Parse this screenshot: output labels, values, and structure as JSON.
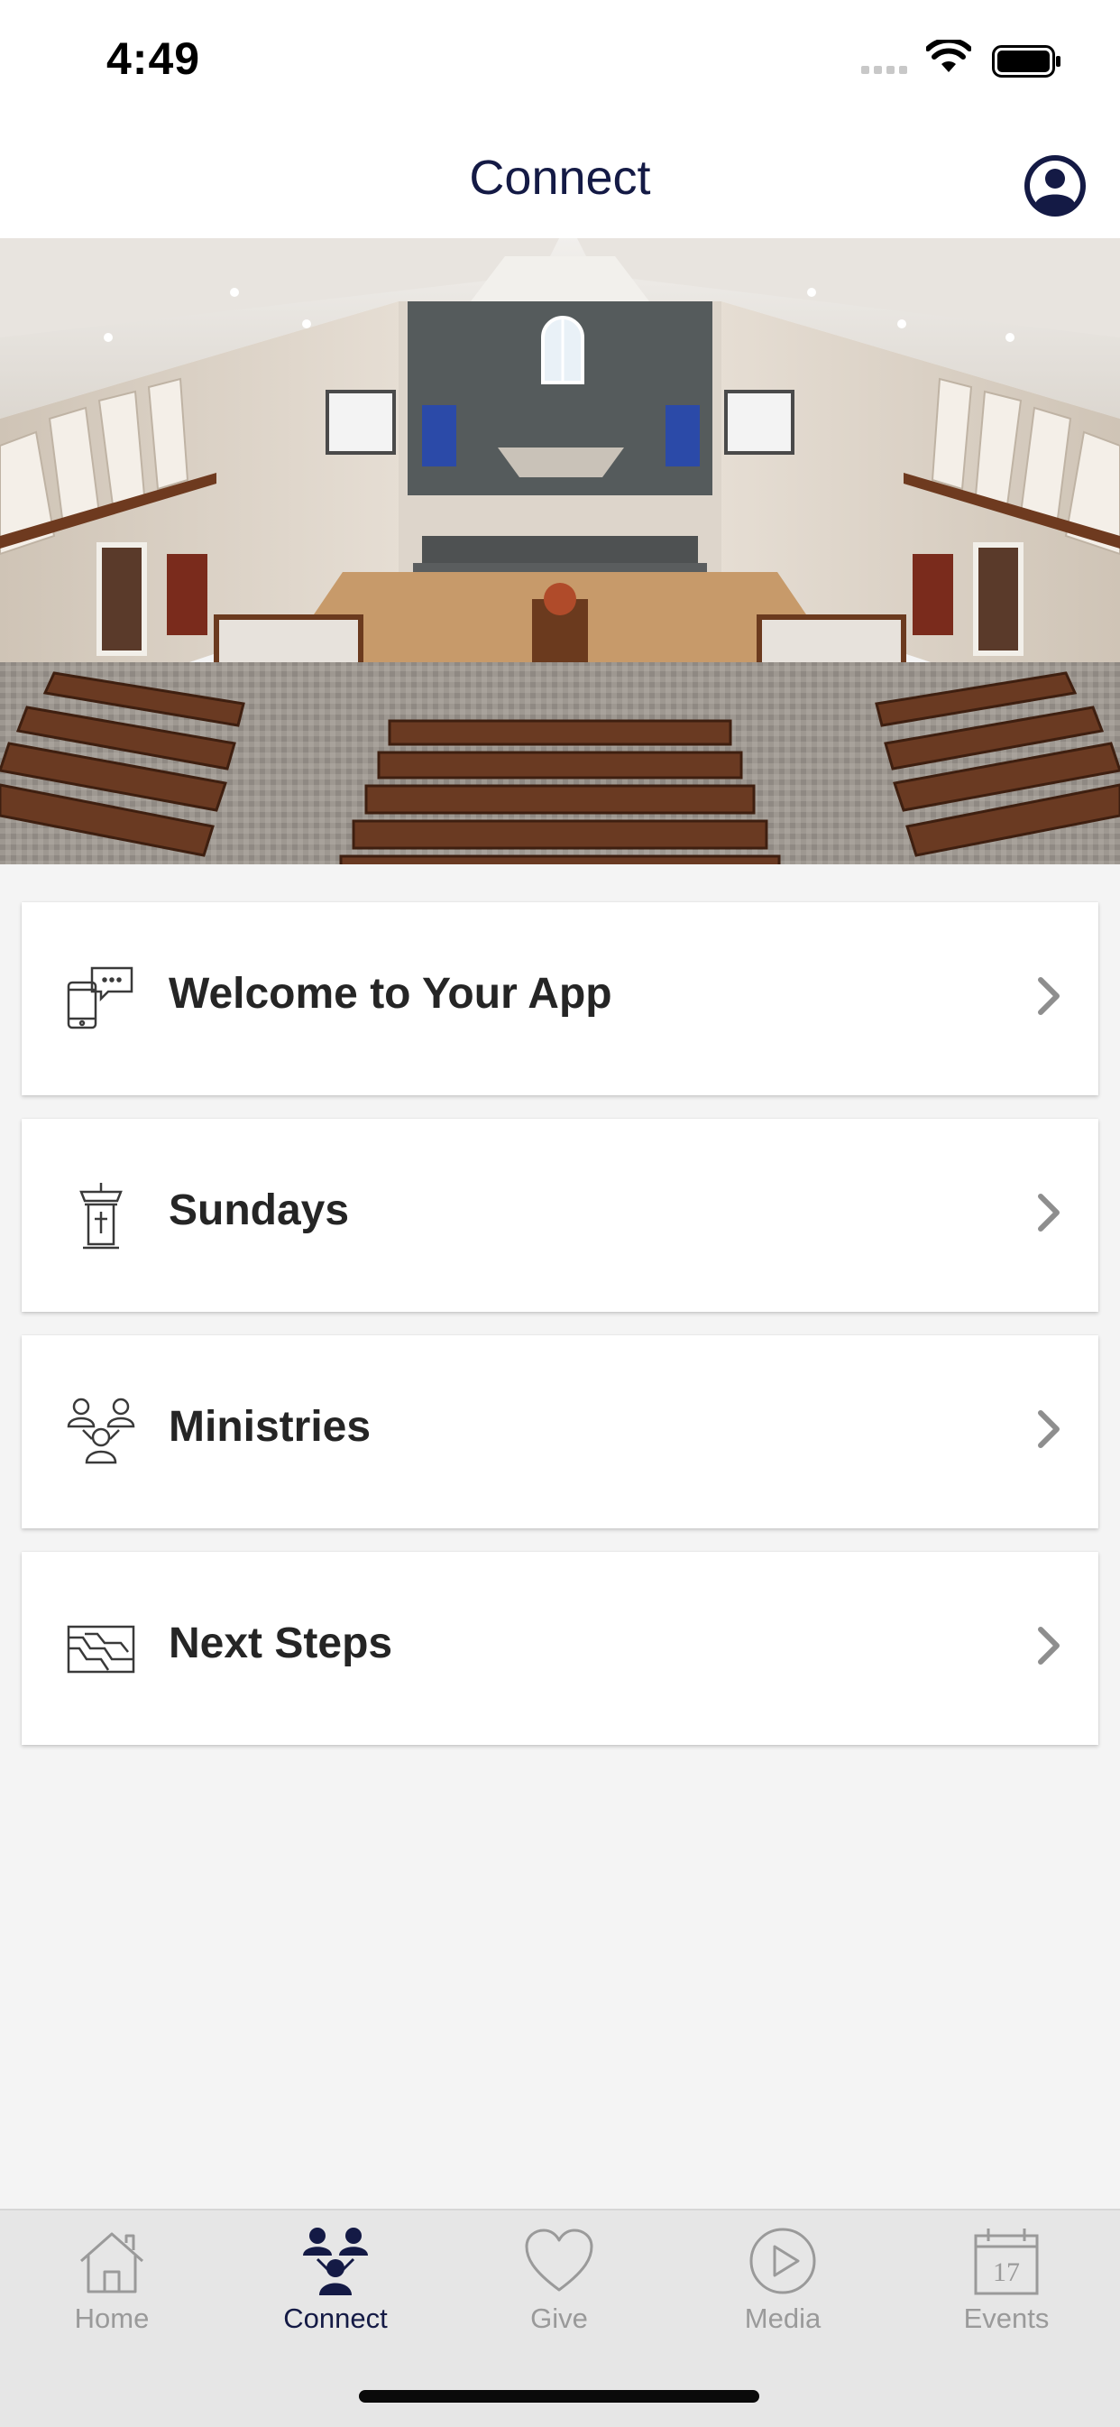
{
  "status_bar": {
    "time": "4:49"
  },
  "header": {
    "title": "Connect",
    "profile_icon": "person-circle-icon"
  },
  "hero": {
    "icon": "church-sanctuary-photo"
  },
  "menu": {
    "items": [
      {
        "label": "Welcome to Your App",
        "icon": "phone-chat-icon"
      },
      {
        "label": "Sundays",
        "icon": "pulpit-icon"
      },
      {
        "label": "Ministries",
        "icon": "people-group-icon"
      },
      {
        "label": "Next Steps",
        "icon": "stairs-steps-icon"
      }
    ]
  },
  "tabs": [
    {
      "label": "Home",
      "icon": "house-icon",
      "active": false
    },
    {
      "label": "Connect",
      "icon": "people-icon",
      "active": true
    },
    {
      "label": "Give",
      "icon": "heart-icon",
      "active": false
    },
    {
      "label": "Media",
      "icon": "play-circle-icon",
      "active": false
    },
    {
      "label": "Events",
      "icon": "calendar-icon",
      "active": false,
      "calendar_day": "17"
    }
  ],
  "colors": {
    "accent": "#141a45",
    "inactive": "#9a9a9a",
    "background": "#f4f4f4",
    "tabbar": "#e6e6e6"
  }
}
